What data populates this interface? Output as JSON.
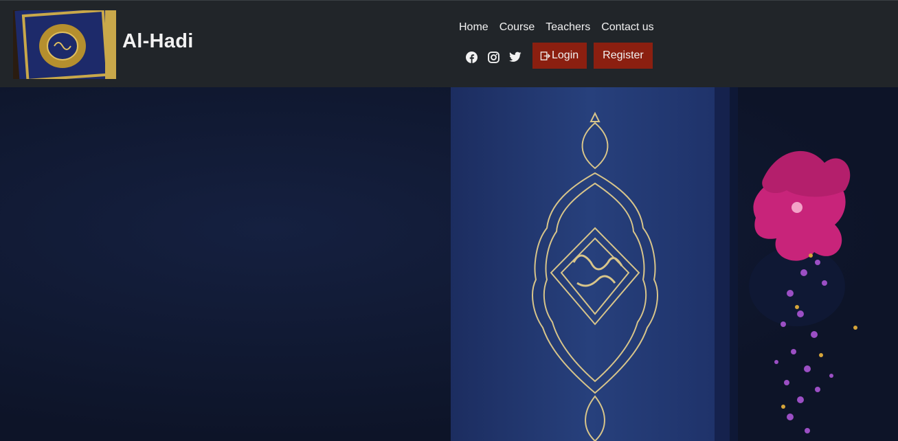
{
  "brand": {
    "title": "Al-Hadi",
    "logo_icon": "quran-book-logo"
  },
  "nav": {
    "links": [
      "Home",
      "Course",
      "Teachers",
      "Contact us"
    ]
  },
  "social": [
    "facebook-icon",
    "instagram-icon",
    "twitter-icon"
  ],
  "auth": {
    "login_label": "Login",
    "register_label": "Register"
  },
  "colors": {
    "navbar_bg": "#212529",
    "button_bg": "#8b1f10",
    "hero_bg": "#111a30",
    "book_blue": "#22356e",
    "gold": "#d8c58a",
    "flower_pink": "#c8247a"
  },
  "hero": {
    "image_icon": "quran-cover-hero-image"
  }
}
